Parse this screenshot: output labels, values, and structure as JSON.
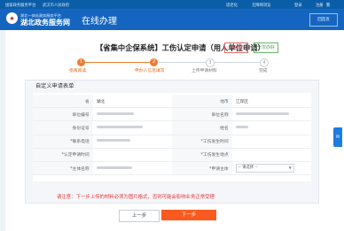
{
  "topbar": {
    "portal": "国家政务服务平台",
    "city": "武汉市人民政府",
    "accessible": "无障碍浏览",
    "login": "登录",
    "register": "注册",
    "chinese_mode": "繁",
    "elder_mode": "适老化"
  },
  "header": {
    "logo_line1": "湖北一体化政务服务平台",
    "logo_line2": "湖北政务服务网",
    "title": "在线办理",
    "home_button": "回首页"
  },
  "main": {
    "title": "【省集中企保系统】工伤认定申请（用人单位申请）",
    "badge_fee": "不收费",
    "badge_once": "一次办好"
  },
  "steps": [
    {
      "num": "1",
      "label": "指南阅读"
    },
    {
      "num": "2",
      "label": "申办人信息填写"
    },
    {
      "num": "3",
      "label": "上传申请材料"
    },
    {
      "num": "4",
      "label": "完成"
    }
  ],
  "panel": {
    "title": "自定义申请表单"
  },
  "form": {
    "rows": [
      {
        "l1": "省",
        "v1": "湖北",
        "l2": "地市",
        "v2": "江岸区"
      },
      {
        "l1": "单位编号",
        "v1": "",
        "l2": "单位名称",
        "v2": ""
      },
      {
        "l1": "身份证号",
        "v1": "",
        "l2": "姓名",
        "v2": ""
      },
      {
        "l1": "*联系电话",
        "v1": "",
        "l2": "*工伤发生时间",
        "v2": ""
      },
      {
        "l1": "*认定申请时间",
        "v1": "",
        "l2": "*工伤发生地点",
        "v2": ""
      },
      {
        "l1": "*主体名称",
        "v1": "",
        "l2": "*申请主体",
        "v2": ""
      }
    ],
    "select_placeholder": "-- 请选择 --"
  },
  "notice": "请注意：下一步上传的材料必须为图片格式，否则可能会影响业务正常受理",
  "buttons": {
    "prev": "上一步",
    "next": "下一步"
  },
  "colors": {
    "header_blue": "#1565c0",
    "accent_orange": "#f07c2e",
    "next_button": "#fb5a1e",
    "notice_red": "#e03a3a"
  }
}
